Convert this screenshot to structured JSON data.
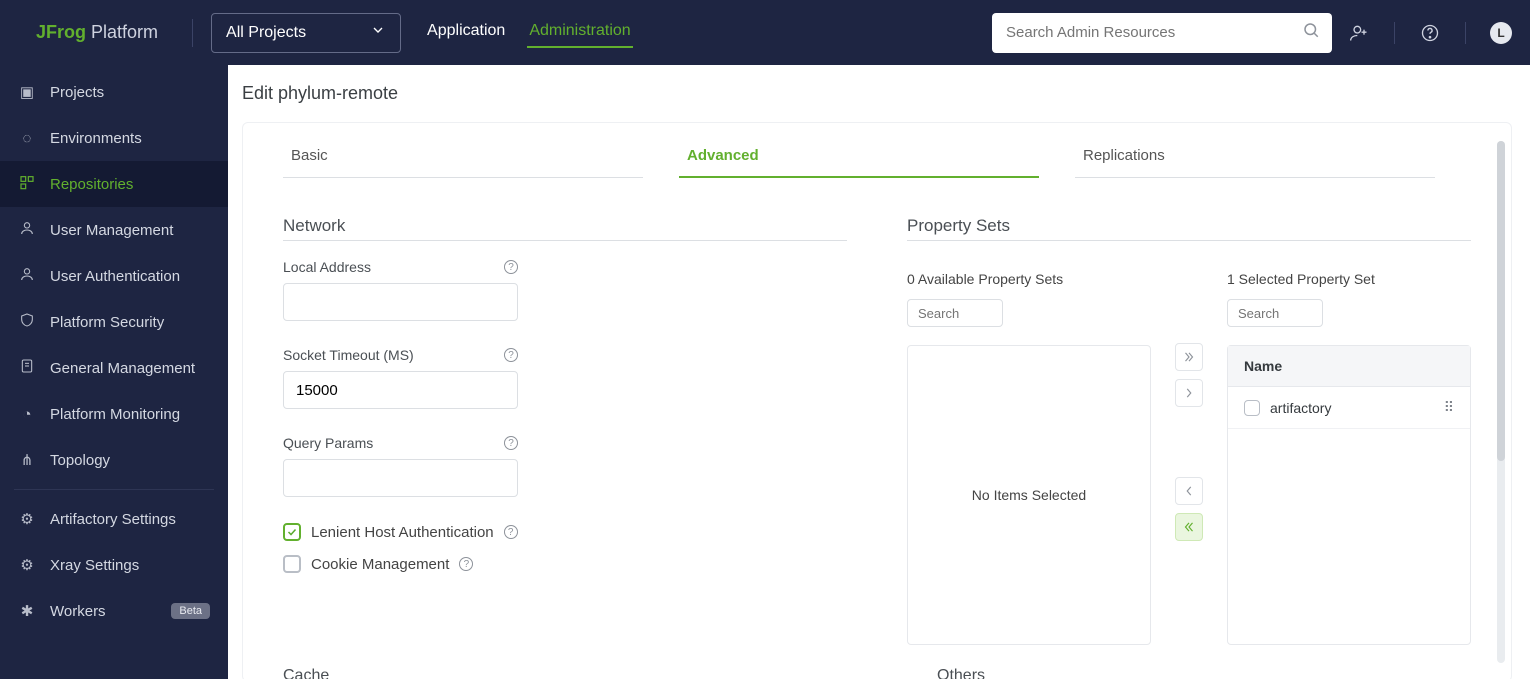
{
  "header": {
    "logo_brand": "JFrog",
    "logo_suffix": " Platform",
    "project_selector": "All Projects",
    "nav": {
      "application": "Application",
      "administration": "Administration"
    },
    "search_placeholder": "Search Admin Resources",
    "avatar_initial": "L"
  },
  "sidebar": {
    "items": [
      {
        "icon": "projects",
        "label": "Projects"
      },
      {
        "icon": "environments",
        "label": "Environments"
      },
      {
        "icon": "repositories",
        "label": "Repositories"
      },
      {
        "icon": "user-mgmt",
        "label": "User Management"
      },
      {
        "icon": "user-auth",
        "label": "User Authentication"
      },
      {
        "icon": "security",
        "label": "Platform Security"
      },
      {
        "icon": "general",
        "label": "General Management"
      },
      {
        "icon": "monitoring",
        "label": "Platform Monitoring"
      },
      {
        "icon": "topology",
        "label": "Topology"
      }
    ],
    "items2": [
      {
        "icon": "artifactory",
        "label": "Artifactory Settings"
      },
      {
        "icon": "xray",
        "label": "Xray Settings"
      },
      {
        "icon": "workers",
        "label": "Workers",
        "badge": "Beta"
      }
    ]
  },
  "page": {
    "title": "Edit phylum-remote"
  },
  "tabs": {
    "basic": "Basic",
    "advanced": "Advanced",
    "replications": "Replications"
  },
  "form": {
    "network_section": "Network",
    "local_address": {
      "label": "Local Address",
      "value": ""
    },
    "socket_timeout": {
      "label": "Socket Timeout (MS)",
      "value": "15000"
    },
    "query_params": {
      "label": "Query Params",
      "value": ""
    },
    "lenient_host": {
      "label": "Lenient Host Authentication",
      "checked": true
    },
    "cookie_mgmt": {
      "label": "Cookie Management",
      "checked": false
    },
    "cache_section": "Cache",
    "others_section": "Others"
  },
  "property_sets": {
    "section": "Property Sets",
    "available_title": "0 Available Property Sets",
    "selected_title": "1 Selected Property Set",
    "search_placeholder": "Search",
    "empty_msg": "No Items Selected",
    "table_header": "Name",
    "rows": [
      {
        "name": "artifactory"
      }
    ]
  }
}
